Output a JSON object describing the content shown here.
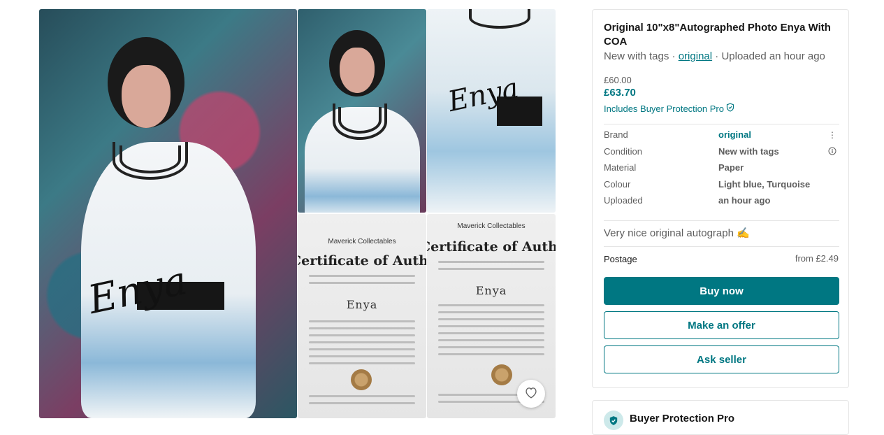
{
  "gallery": {
    "photos": [
      {
        "alt": "Enya autographed photo - main",
        "signature": "Enya"
      },
      {
        "alt": "Enya autographed photo - upper body",
        "signature": "Enya"
      },
      {
        "alt": "Enya autographed photo - dress detail",
        "signature": "Enya"
      },
      {
        "alt": "Certificate of authenticity",
        "org": "Maverick Collectables",
        "title": "Certificate of Authentici",
        "name": "Enya"
      },
      {
        "alt": "Certificate of authenticity close-up",
        "org": "Maverick Collectables",
        "title": "Certificate of Authen",
        "name": "Enya"
      }
    ],
    "favourite_icon": "heart-icon"
  },
  "item": {
    "title": "Original 10\"x8\"Autographed Photo Enya With COA",
    "condition_short": "New with tags",
    "separator": "·",
    "brand_link": "original",
    "uploaded": "Uploaded an hour ago",
    "price_original": "£60.00",
    "price_total": "£63.70",
    "protection_label": "Includes Buyer Protection Pro",
    "details": [
      {
        "key": "Brand",
        "value": "original",
        "link": true,
        "icon": "more-vertical-icon"
      },
      {
        "key": "Condition",
        "value": "New with tags",
        "icon": "info-icon"
      },
      {
        "key": "Material",
        "value": "Paper"
      },
      {
        "key": "Colour",
        "value": "Light blue, Turquoise"
      },
      {
        "key": "Uploaded",
        "value": "an hour ago"
      }
    ],
    "description": "Very nice original autograph ✍️",
    "postage_label": "Postage",
    "postage_value": "from £2.49"
  },
  "actions": {
    "buy_now": "Buy now",
    "make_offer": "Make an offer",
    "ask_seller": "Ask seller"
  },
  "buyer_protection": {
    "title": "Buyer Protection Pro"
  },
  "colors": {
    "accent": "#007782",
    "text": "#171717",
    "muted": "#5e5e5e"
  }
}
